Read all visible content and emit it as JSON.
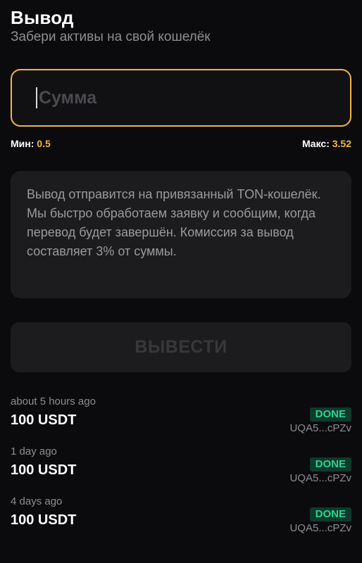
{
  "header": {
    "title": "Вывод",
    "subtitle": "Забери активы на свой кошелёк"
  },
  "amount": {
    "placeholder": "Сумма",
    "value": ""
  },
  "limits": {
    "min_label": "Мин:",
    "min_value": "0.5",
    "max_label": "Макс:",
    "max_value": "3.52"
  },
  "info": {
    "text": "Вывод отправится на привязанный TON-кошелёк. Мы быстро обработаем заявку и сообщим, когда перевод будет завершён. Комиссия за вывод составляет 3% от суммы."
  },
  "withdraw_button": {
    "label": "ВЫВЕСТИ"
  },
  "history": [
    {
      "time": "about 5 hours ago",
      "amount": "100 USDT",
      "status": "DONE",
      "address": "UQA5...cPZv"
    },
    {
      "time": "1 day ago",
      "amount": "100 USDT",
      "status": "DONE",
      "address": "UQA5...cPZv"
    },
    {
      "time": "4 days ago",
      "amount": "100 USDT",
      "status": "DONE",
      "address": "UQA5...cPZv"
    }
  ],
  "colors": {
    "background": "#0b0b0d",
    "accent": "#f0b64a",
    "success": "#2bd48e",
    "card": "#1c1c1e"
  }
}
